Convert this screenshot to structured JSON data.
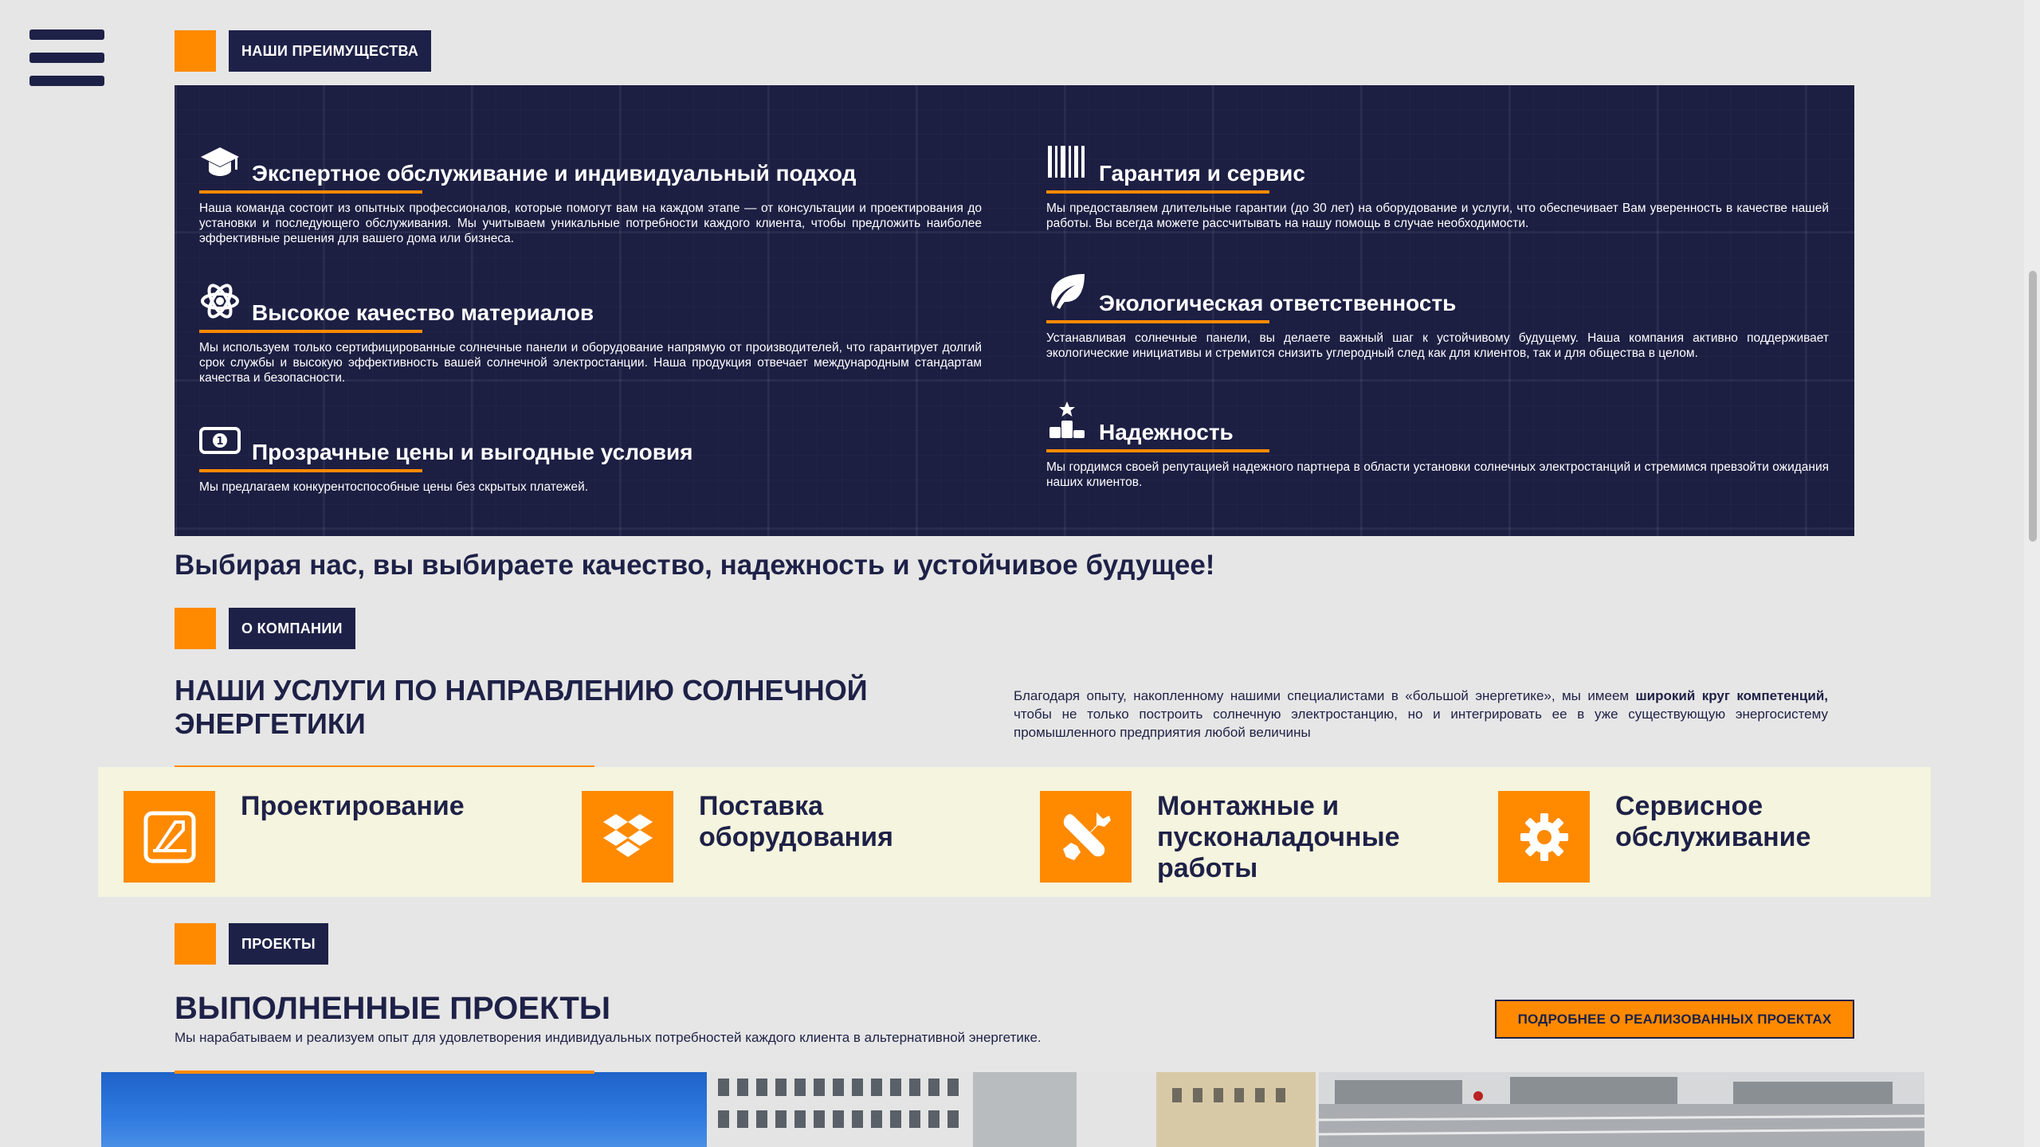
{
  "nav": {
    "menu_icon": "hamburger-menu-icon"
  },
  "advantages": {
    "tag": "НАШИ ПРЕИМУЩЕСТВА",
    "items": [
      {
        "icon": "graduation-cap-icon",
        "title": "Экспертное обслуживание и индивидуальный подход",
        "text": "Наша команда состоит из опытных профессионалов, которые помогут вам на каждом этапе — от консультации и проектирования до установки и последующего обслуживания. Мы учитываем уникальные потребности каждого клиента, чтобы предложить наиболее эффективные решения для вашего дома или бизнеса."
      },
      {
        "icon": "barcode-icon",
        "title": "Гарантия и сервис",
        "text": "Мы предоставляем длительные гарантии (до 30 лет) на оборудование и услуги, что обеспечивает Вам уверенность в качестве нашей работы. Вы всегда можете рассчитывать на нашу помощь в случае необходимости."
      },
      {
        "icon": "atom-icon",
        "title": "Высокое качество материалов",
        "text": "Мы используем только сертифицированные солнечные панели и оборудование напрямую от производителей, что гарантирует долгий срок службы и высокую эффективность вашей солнечной электростанции. Наша продукция отвечает международным стандартам качества и безопасности."
      },
      {
        "icon": "leaf-icon",
        "title": "Экологическая ответственность",
        "text": "Устанавливая солнечные панели, вы делаете важный шаг к устойчивому будущему. Наша компания активно поддерживает экологические инициативы и стремится снизить углеродный след как для клиентов, так и для общества в целом."
      },
      {
        "icon": "banknote-icon",
        "title": "Прозрачные цены и выгодные условия",
        "text": "Мы предлагаем конкурентоспособные цены без скрытых платежей."
      },
      {
        "icon": "podium-star-icon",
        "title": "Надежность",
        "text": "Мы гордимся своей репутацией надежного партнера в области установки солнечных электростанций и стремимся превзойти ожидания наших клиентов."
      }
    ]
  },
  "slogan": "Выбирая нас, вы выбираете качество, надежность и устойчивое будущее!",
  "about": {
    "tag": "О КОМПАНИИ",
    "title": "НАШИ УСЛУГИ ПО НАПРАВЛЕНИЮ СОЛНЕЧНОЙ ЭНЕРГЕТИКИ",
    "desc_before": "Благодаря опыту, накопленному нашими специалистами в «большой энергетике», мы имеем ",
    "desc_bold": "широкий круг компетенций,",
    "desc_after": " чтобы не только построить солнечную электростанцию, но и интегрировать ее в уже существующую энергосистему промышленного предприятия любой величины",
    "services": [
      {
        "icon": "design-tool-icon",
        "label": "Проектирование"
      },
      {
        "icon": "dropbox-boxes-icon",
        "label": "Поставка оборудования"
      },
      {
        "icon": "wrench-screwdriver-icon",
        "label": "Монтажные и пусконаладочные работы"
      },
      {
        "icon": "gear-icon",
        "label": "Сервисное обслуживание"
      }
    ]
  },
  "projects": {
    "tag": "ПРОЕКТЫ",
    "title": "ВЫПОЛНЕННЫЕ ПРОЕКТЫ",
    "desc": "Мы нарабатываем и реализуем опыт для удовлетворения индивидуальных потребностей каждого клиента в альтернативной энергетике.",
    "button": "ПОДРОБНЕЕ О РЕАЛИЗОВАННЫХ ПРОЕКТАХ"
  },
  "colors": {
    "accent": "#ff8a00",
    "navy": "#1e2147",
    "panel": "#1c1e42",
    "band": "#f5f4de",
    "page": "#e6e6e6"
  }
}
